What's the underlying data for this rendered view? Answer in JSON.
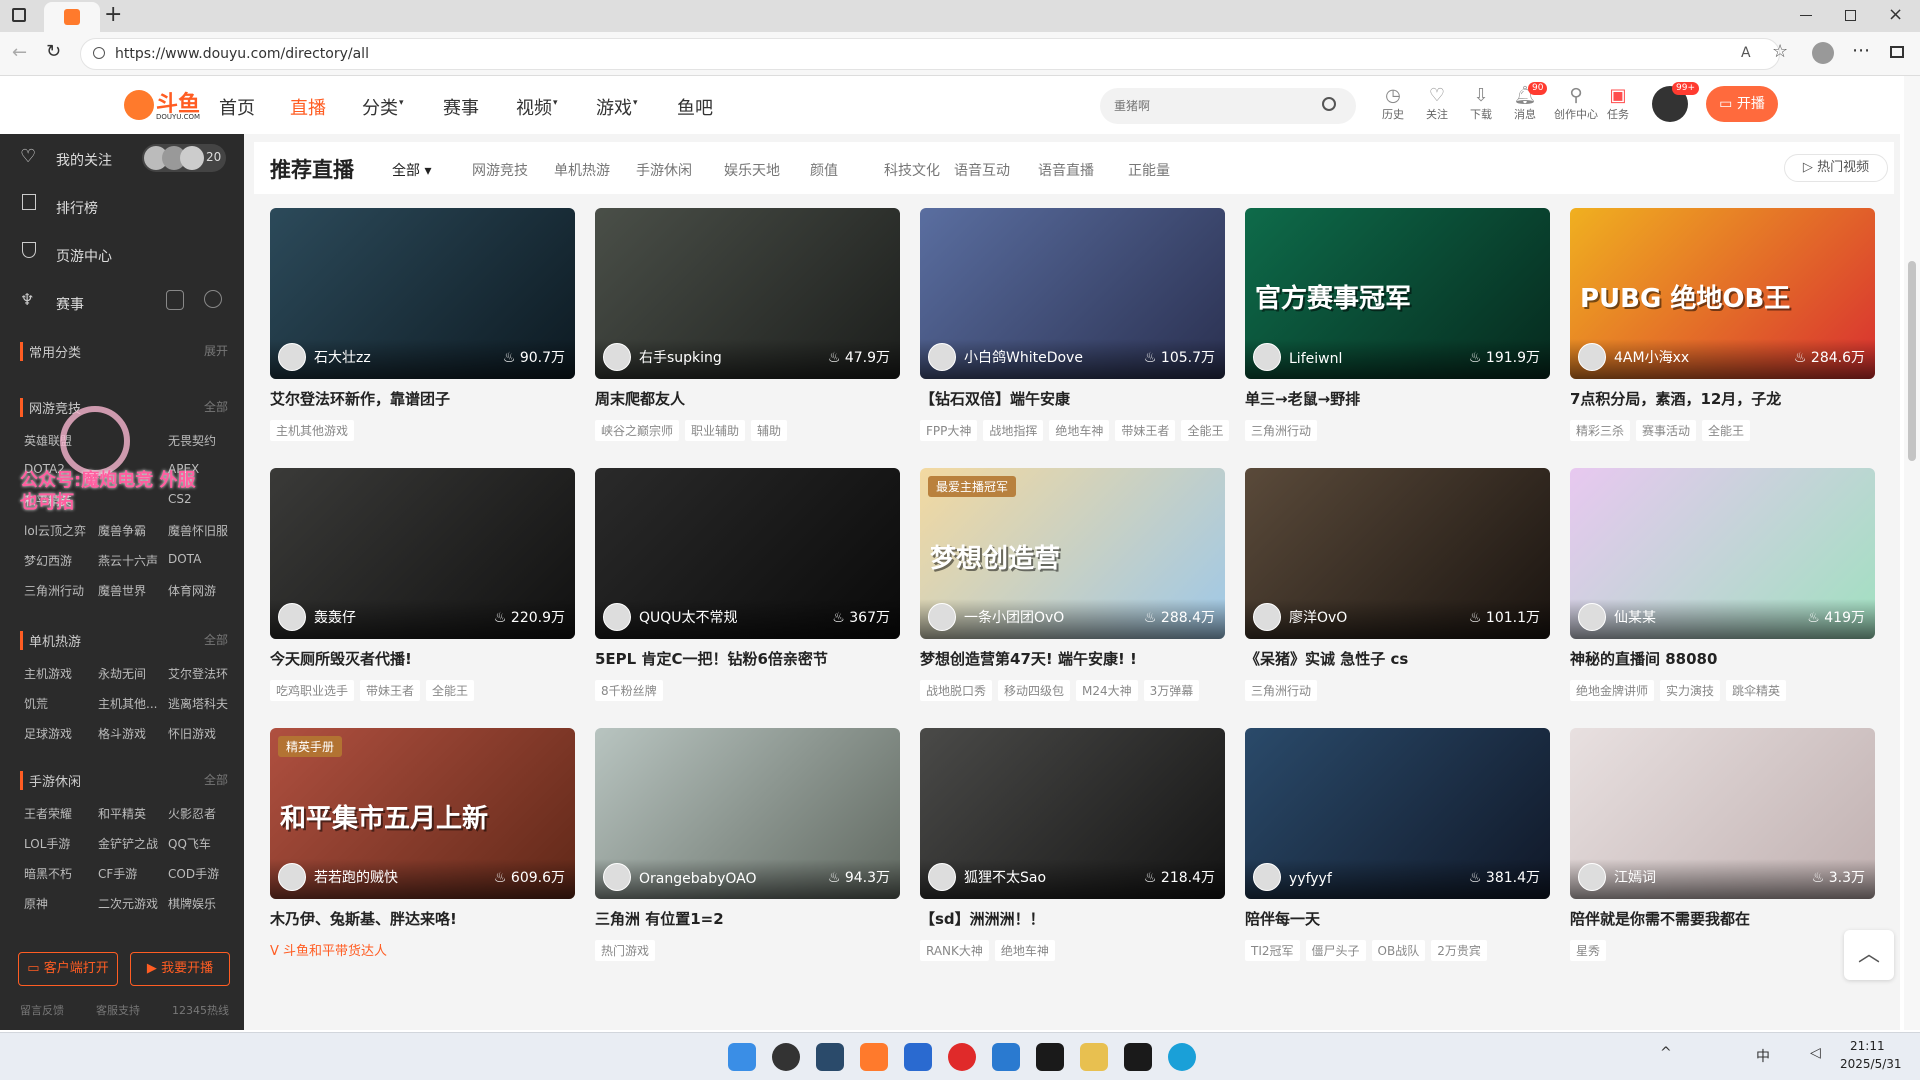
{
  "browser": {
    "url": "https://www.douyu.com/directory/all",
    "new_tab": "+"
  },
  "header": {
    "logo": "斗鱼",
    "logo_sub": "DOUYU.COM",
    "nav": [
      "首页",
      "直播",
      "分类",
      "赛事",
      "视频",
      "游戏",
      "鱼吧"
    ],
    "active_nav": "直播",
    "search_placeholder": "重猪啊",
    "icons": [
      "历史",
      "关注",
      "下载",
      "消息",
      "创作中心",
      "任务"
    ],
    "msg_badge": "90",
    "avatar_badge": "99+",
    "start_live": "开播"
  },
  "sidebar": {
    "follow": "我的关注",
    "follow_count": "20",
    "rank": "排行榜",
    "page_center": "页游中心",
    "match": "赛事",
    "common_cat": "常用分类",
    "expand": "展开",
    "online_game": "网游竞技",
    "all": "全部",
    "online_items": [
      "英雄联盟",
      "",
      "无畏契约",
      "DOTA2",
      "",
      "APEX",
      "和平精英",
      "",
      "CS2",
      "lol云顶之弈",
      "魔兽争霸",
      "魔兽怀旧服",
      "梦幻西游",
      "燕云十六声",
      "DOTA",
      "三角洲行动",
      "魔兽世界",
      "体育网游"
    ],
    "single_game": "单机热游",
    "single_items": [
      "主机游戏",
      "永劫无间",
      "艾尔登法环",
      "饥荒",
      "主机其他...",
      "逃离塔科夫",
      "足球游戏",
      "格斗游戏",
      "怀旧游戏"
    ],
    "mobile": "手游休闲",
    "mobile_items": [
      "王者荣耀",
      "和平精英",
      "火影忍者",
      "LOL手游",
      "金铲铲之战",
      "QQ飞车",
      "暗黑不朽",
      "CF手游",
      "COD手游",
      "原神",
      "二次元游戏",
      "棋牌娱乐"
    ],
    "client_btn": "客户端打开",
    "live_btn": "我要开播",
    "footer": [
      "留言反馈",
      "客服支持",
      "12345热线"
    ],
    "watermark": "公众号:魔炮电竞 外服也可拓"
  },
  "subnav": {
    "title": "推荐直播",
    "all": "全部",
    "cats": [
      "网游竞技",
      "单机热游",
      "手游休闲",
      "娱乐天地",
      "颜值",
      "科技文化",
      "语音互动",
      "语音直播",
      "正能量"
    ],
    "hot_video": "热门视频"
  },
  "cards": [
    {
      "anchor": "石大壮zz",
      "hot": "90.7万",
      "title": "艾尔登法环新作，靠谱团子",
      "tags": [
        "主机其他游戏"
      ],
      "c1": "#2c4a5a",
      "c2": "#0d1a22"
    },
    {
      "anchor": "右手supking",
      "hot": "47.9万",
      "title": "周末爬都友人",
      "tags": [
        "峡谷之巅宗师",
        "职业辅助",
        "辅助"
      ],
      "c1": "#4a4f48",
      "c2": "#1c1e1c"
    },
    {
      "anchor": "小白鸽WhiteDove",
      "hot": "105.7万",
      "title": "【钻石双倍】端午安康",
      "tags": [
        "FPP大神",
        "战地指挥",
        "绝地车神",
        "带妹王者",
        "全能王"
      ],
      "c1": "#5a6ea0",
      "c2": "#2a3050"
    },
    {
      "anchor": "Lifeiwnl",
      "hot": "191.9万",
      "title": "单三→老鼠→野排",
      "tags": [
        "三角洲行动"
      ],
      "c1": "#0e6b4a",
      "c2": "#062a1e",
      "banner": "官方赛事冠军"
    },
    {
      "anchor": "4AM小海xx",
      "hot": "284.6万",
      "title": "7点积分局，素酒，12月，子龙",
      "tags": [
        "精彩三杀",
        "赛事活动",
        "全能王"
      ],
      "c1": "#f0b020",
      "c2": "#d83030",
      "banner": "PUBG 绝地OB王"
    },
    {
      "anchor": "轰轰仔",
      "hot": "220.9万",
      "title": "今天厕所毁灭者代播!",
      "tags": [
        "吃鸡职业选手",
        "带妹王者",
        "全能王"
      ],
      "c1": "#3a3a38",
      "c2": "#111"
    },
    {
      "anchor": "QUQU太不常规",
      "hot": "367万",
      "title": "5EPL 肯定C一把！钻粉6倍亲密节",
      "tags": [
        "8千粉丝牌"
      ],
      "c1": "#2a2a2a",
      "c2": "#0a0a0a"
    },
    {
      "anchor": "一条小团团OvO",
      "hot": "288.4万",
      "title": "梦想创造营第47天! 端午安康! !",
      "tags": [
        "战地脱口秀",
        "移动四级包",
        "M24大神",
        "3万弹幕"
      ],
      "c1": "#f3d9a0",
      "c2": "#9ec8e8",
      "badge": "最爱主播冠军",
      "banner": "梦想创造营"
    },
    {
      "anchor": "廖洋OvO",
      "hot": "101.1万",
      "title": "《呆猪》实诚 急性子 cs",
      "tags": [
        "三角洲行动"
      ],
      "c1": "#5a4a3a",
      "c2": "#1a1410"
    },
    {
      "anchor": "仙某某",
      "hot": "419万",
      "title": "神秘的直播间 88080",
      "tags": [
        "绝地金牌讲师",
        "实力演技",
        "跳伞精英"
      ],
      "c1": "#e8c8f0",
      "c2": "#a0e0c0"
    },
    {
      "anchor": "若若跑的贼快",
      "hot": "609.6万",
      "title": "木乃伊、兔斯基、胖达来咯!",
      "tags": [],
      "extra": "斗鱼和平带货达人",
      "c1": "#b05040",
      "c2": "#602818",
      "badge": "精英手册",
      "banner": "和平集市五月上新"
    },
    {
      "anchor": "OrangebabyOAO",
      "hot": "94.3万",
      "title": "三角洲 有位置1=2",
      "tags": [
        "热门游戏"
      ],
      "c1": "#b8c4c0",
      "c2": "#606860"
    },
    {
      "anchor": "狐狸不太Sao",
      "hot": "218.4万",
      "title": "【sd】洲洲洲！！",
      "tags": [
        "RANK大神",
        "绝地车神"
      ],
      "c1": "#4a4a48",
      "c2": "#141414"
    },
    {
      "anchor": "yyfyyf",
      "hot": "381.4万",
      "title": "陪伴每一天",
      "tags": [
        "TI2冠军",
        "僵尸头子",
        "OB战队",
        "2万贵宾"
      ],
      "c1": "#2a4a6a",
      "c2": "#101828"
    },
    {
      "anchor": "江嫣词",
      "hot": "3.3万",
      "title": "陪伴就是你需不需要我都在",
      "tags": [
        "星秀"
      ],
      "c1": "#e8e0e0",
      "c2": "#c0b0b0"
    }
  ],
  "taskbar": {
    "time": "21:11",
    "date": "2025/5/31",
    "ime": "中"
  }
}
